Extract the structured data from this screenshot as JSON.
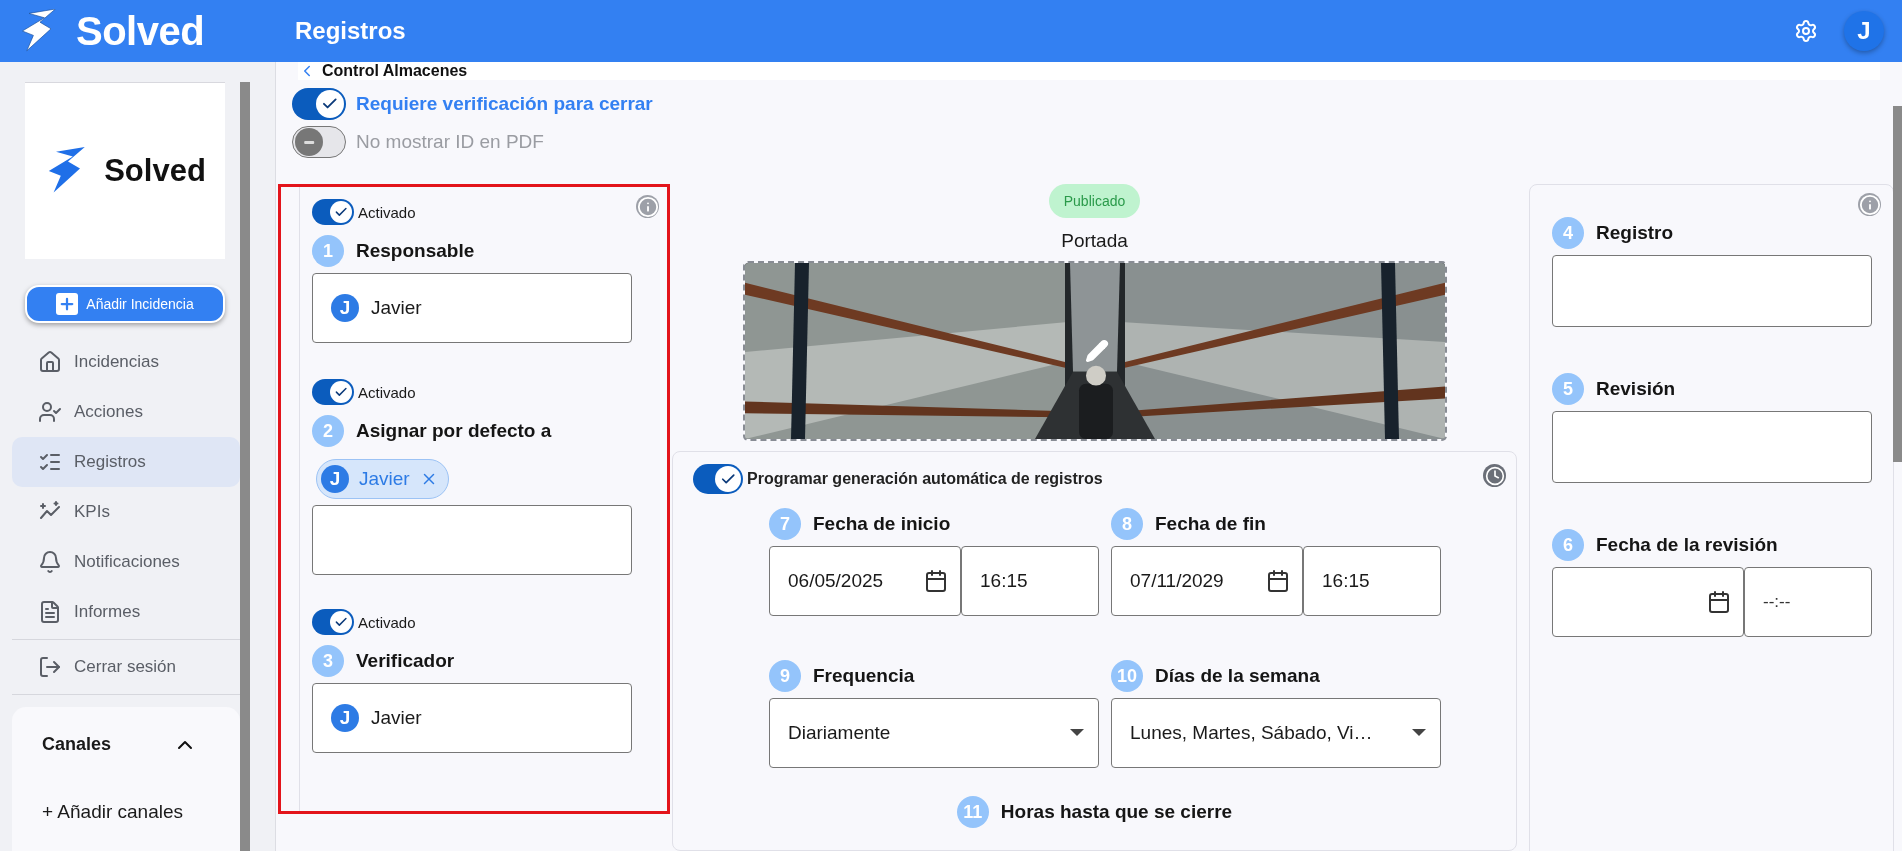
{
  "header": {
    "brand": "Solved",
    "title": "Registros",
    "avatar": "J"
  },
  "sidebar": {
    "logo_text": "Solved",
    "add_button": "Añadir Incidencia",
    "items": [
      {
        "label": "Incidencias",
        "selected": false
      },
      {
        "label": "Acciones",
        "selected": false
      },
      {
        "label": "Registros",
        "selected": true
      },
      {
        "label": "KPIs",
        "selected": false
      },
      {
        "label": "Notificaciones",
        "selected": false
      },
      {
        "label": "Informes",
        "selected": false
      }
    ],
    "logout": "Cerrar sesión",
    "channels": {
      "title": "Canales",
      "expanded": true,
      "add": "+ Añadir canales"
    }
  },
  "page": {
    "title": "Control Almacenes",
    "options": [
      {
        "label": "Requiere verificación para cerrar",
        "on": true
      },
      {
        "label": "No mostrar ID en PDF",
        "on": false
      }
    ]
  },
  "roles": [
    {
      "toggle": "Activado",
      "on": true,
      "number": "1",
      "label": "Responsable",
      "kind": "single",
      "user": {
        "initial": "J",
        "name": "Javier"
      }
    },
    {
      "toggle": "Activado",
      "on": true,
      "number": "2",
      "label": "Asignar por defecto a",
      "kind": "multi",
      "chips": [
        {
          "initial": "J",
          "name": "Javier"
        }
      ]
    },
    {
      "toggle": "Activado",
      "on": true,
      "number": "3",
      "label": "Verificador",
      "kind": "single",
      "user": {
        "initial": "J",
        "name": "Javier"
      }
    }
  ],
  "cover": {
    "status": "Publicado",
    "title": "Portada"
  },
  "schedule": {
    "label": "Programar generación automática de registros",
    "on": true,
    "start": {
      "number": "7",
      "label": "Fecha de inicio",
      "date": "06/05/2025",
      "time": "16:15"
    },
    "end": {
      "number": "8",
      "label": "Fecha de fin",
      "date": "07/11/2029",
      "time": "16:15"
    },
    "frequency": {
      "number": "9",
      "label": "Frequencia",
      "value": "Diariamente"
    },
    "days": {
      "number": "10",
      "label": "Días de la semana",
      "value": "Lunes, Martes, Sábado, Vi…"
    },
    "close_hours": {
      "number": "11",
      "label": "Horas hasta que se cierre"
    }
  },
  "document": {
    "fields": [
      {
        "number": "4",
        "label": "Registro",
        "kind": "text"
      },
      {
        "number": "5",
        "label": "Revisión",
        "kind": "text"
      },
      {
        "number": "6",
        "label": "Fecha de la revisión",
        "kind": "datetime",
        "time_placeholder": "--:--"
      }
    ]
  }
}
